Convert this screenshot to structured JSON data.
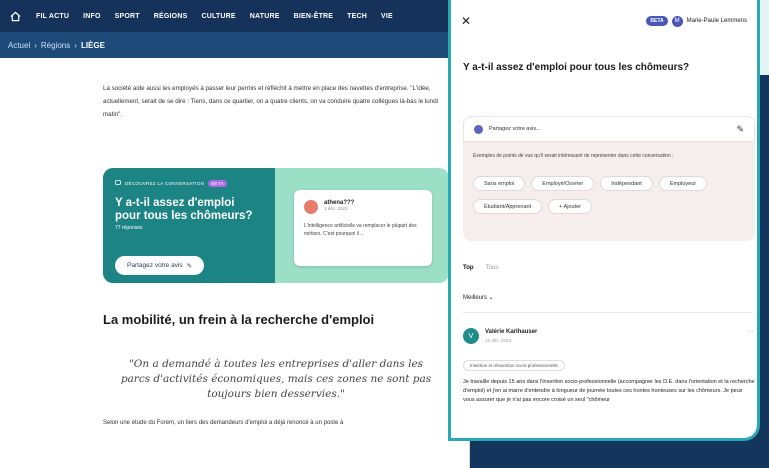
{
  "nav": {
    "items": [
      "FIL ACTU",
      "INFO",
      "SPORT",
      "RÉGIONS",
      "CULTURE",
      "NATURE",
      "BIEN-ÊTRE",
      "TECH",
      "VIE"
    ]
  },
  "breadcrumb": {
    "home": "Actuel",
    "sep1": "›",
    "region": "Régions",
    "sep2": "›",
    "current": "LIÈGE"
  },
  "article": {
    "intro": "La société aide aussi les employés à passer leur permis et réfléchit à mettre en place des navettes d'entreprise. \"L'idée, actuellement, serait de se dire : Tiens, dans ce quartier, on a quatre clients, on va conduire quatre collègues là-bas le lundi matin\".",
    "section_heading": "La mobilité, un frein à la recherche d'emploi",
    "quote": "\"On a demandé à toutes les entreprises d'aller dans les parcs d'activités économiques, mais ces zones ne sont pas toujours bien desservies.\"",
    "last_line": "Selon une étude du Forem, un tiers des demandeurs d'emploi a déjà renoncé à un poste à"
  },
  "promo": {
    "eyebrow": "DÉCOUVREZ LA CONVERSATION",
    "beta": "BETA",
    "title": "Y a-t-il assez d'emploi pour tous les chômeurs?",
    "sub": "77 réponses",
    "button": "Partagez votre avis",
    "card_name": "athena???",
    "card_date": "1 déc. 2023",
    "card_text": "L'intelligence artificielle va remplacer le plupart des métiers. C'est pourquoi il ..."
  },
  "panel": {
    "close": "✕",
    "beta": "BETA",
    "user_initial": "M",
    "user_name": "Marie-Paule Lemmens",
    "title": "Y a-t-il assez d'emploi pour tous les chômeurs?",
    "share_placeholder": "Partagez votre avis...",
    "edit": "✎",
    "hint": "Exemples de points de vue qu'il serait intéressant de représenter dans cette conversation :",
    "chips": [
      "Sans emploi",
      "Employé/Ouvrier",
      "Indépendant",
      "Employeur",
      "Étudiant/Apprenant",
      "+ Ajouter"
    ],
    "tabs": [
      "Top",
      "Tous"
    ],
    "sort": "Meilleurs ⌄",
    "comment": {
      "initial": "V",
      "name": "Valérie Karlhauser",
      "date": "12 déc. 2023",
      "more": "···",
      "tag": "Insertion et réinsertion socio-professionnelle",
      "text": "Je travaille depuis 15 ans dans l'insertion socio-professionnelle (accompagner les D.E. dans l'orientation et la recherche d'emploi) et j'en ai marre d'entendre à longueur de journée toutes ces hontes honteuses sur les chômeurs. Je peux vous assurer que je n'ai pas encore croisé un seul \"chômeur"
    }
  }
}
